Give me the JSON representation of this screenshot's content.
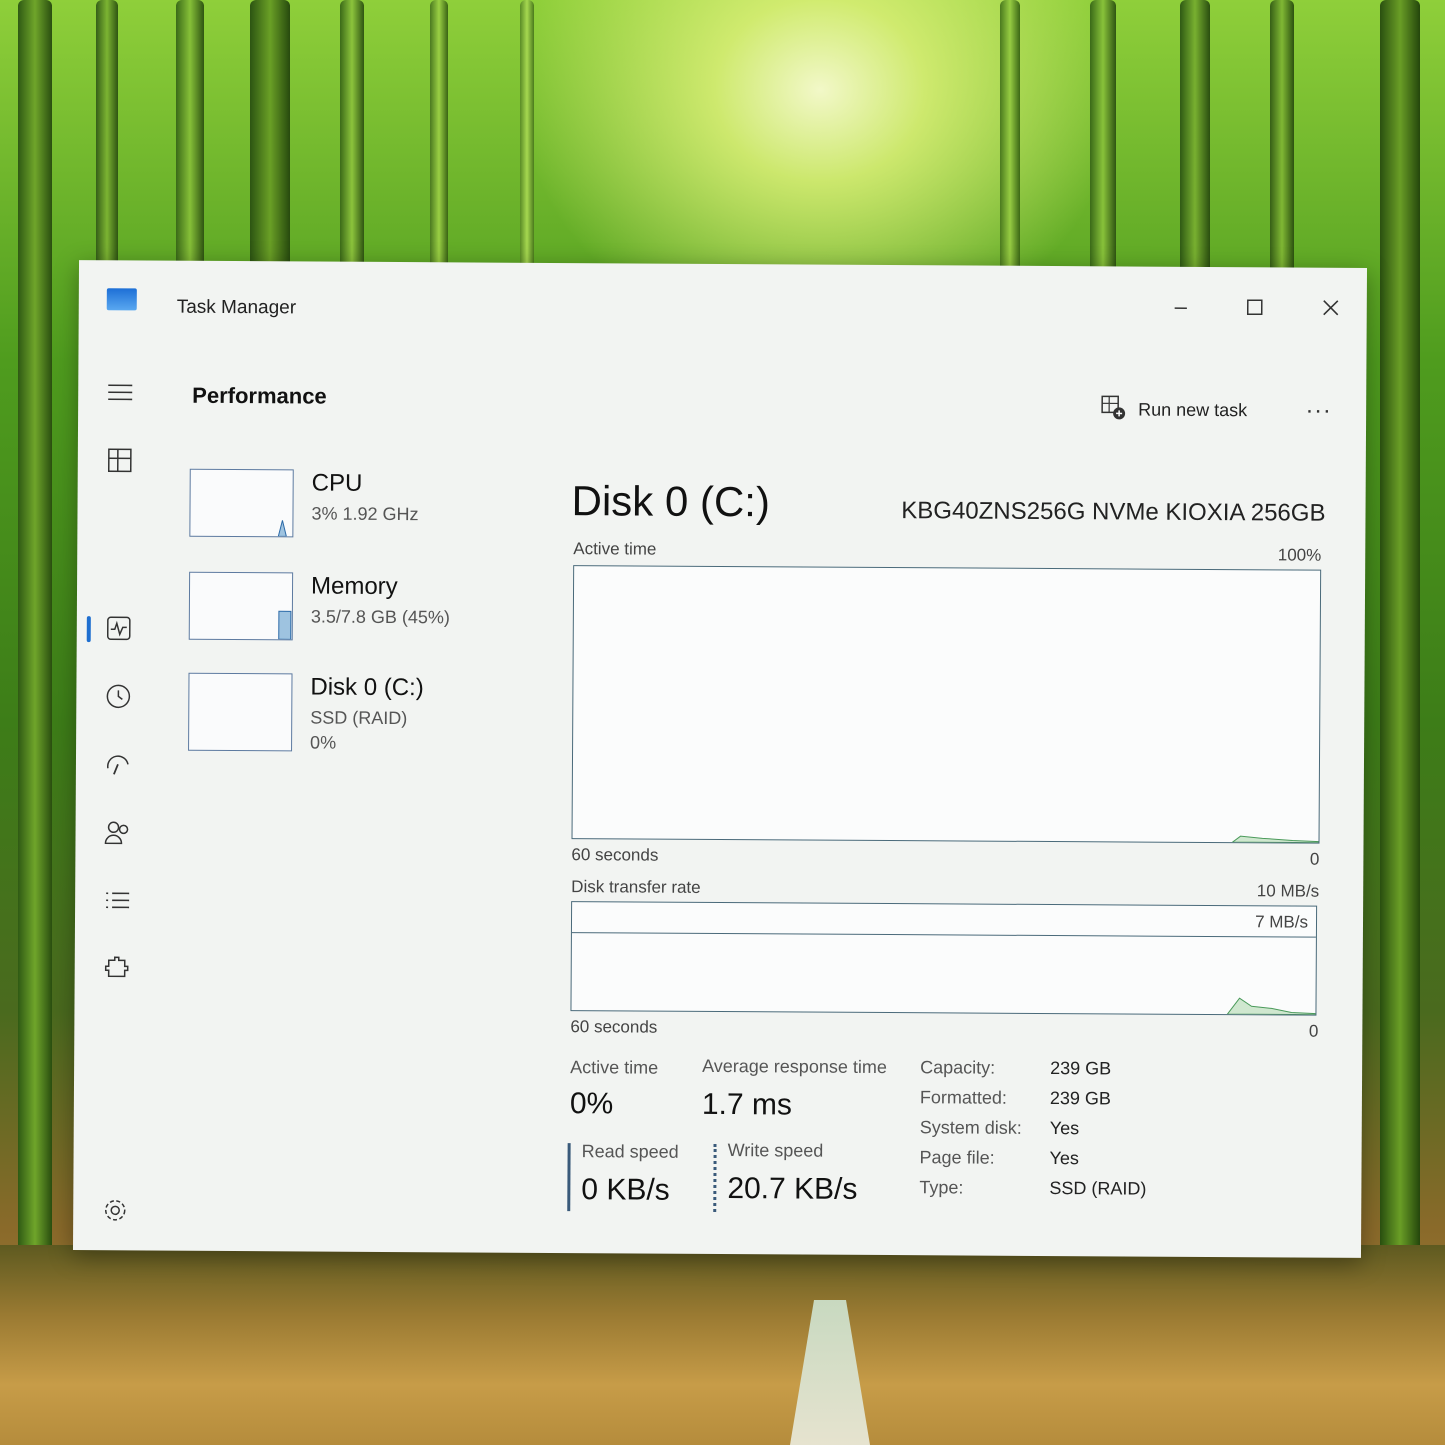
{
  "window": {
    "title": "Task Manager",
    "minimize_icon": "minimize-icon",
    "maximize_icon": "maximize-icon",
    "close_icon": "close-icon"
  },
  "nav": [
    {
      "icon": "hamburger-menu-icon"
    },
    {
      "icon": "processes-icon"
    },
    {
      "icon": "performance-icon",
      "active": true
    },
    {
      "icon": "app-history-icon"
    },
    {
      "icon": "startup-apps-icon"
    },
    {
      "icon": "users-icon"
    },
    {
      "icon": "details-icon"
    },
    {
      "icon": "services-icon"
    },
    {
      "icon": "settings-icon"
    }
  ],
  "header": {
    "title": "Performance",
    "run_new_task": "Run new task",
    "more": "..."
  },
  "sidebar": [
    {
      "name": "CPU",
      "sub1": "3%  1.92 GHz",
      "sub2": ""
    },
    {
      "name": "Memory",
      "sub1": "3.5/7.8 GB (45%)",
      "sub2": ""
    },
    {
      "name": "Disk 0 (C:)",
      "sub1": "SSD (RAID)",
      "sub2": "0%"
    }
  ],
  "detail": {
    "title": "Disk 0 (C:)",
    "model": "KBG40ZNS256G NVMe KIOXIA 256GB",
    "active_graph": {
      "label": "Active time",
      "max": "100%",
      "time": "60 seconds",
      "min": "0"
    },
    "transfer_graph": {
      "label": "Disk transfer rate",
      "max": "10 MB/s",
      "marker": "7 MB/s",
      "time": "60 seconds",
      "min": "0"
    },
    "stats": {
      "active_time_label": "Active time",
      "active_time_value": "0%",
      "avg_response_label": "Average response time",
      "avg_response_value": "1.7 ms",
      "read_label": "Read speed",
      "read_value": "0 KB/s",
      "write_label": "Write speed",
      "write_value": "20.7 KB/s"
    },
    "properties": [
      {
        "key": "Capacity:",
        "value": "239 GB"
      },
      {
        "key": "Formatted:",
        "value": "239 GB"
      },
      {
        "key": "System disk:",
        "value": "Yes"
      },
      {
        "key": "Page file:",
        "value": "Yes"
      },
      {
        "key": "Type:",
        "value": "SSD (RAID)"
      }
    ]
  },
  "colors": {
    "accent": "#1f6fd0",
    "graph_line": "#4a6a7a",
    "window_bg": "#f2f4f2"
  }
}
